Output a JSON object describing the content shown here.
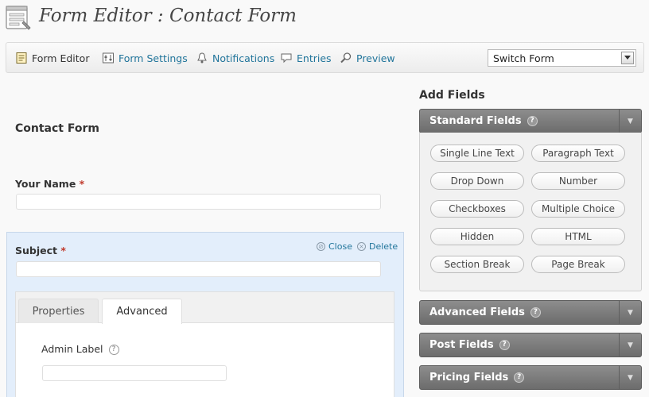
{
  "header": {
    "title": "Form Editor : Contact Form",
    "icon": "form-editor-icon"
  },
  "toolbar": {
    "items": [
      {
        "label": "Form Editor",
        "icon": "form-editor-icon",
        "active": true
      },
      {
        "label": "Form Settings",
        "icon": "settings-icon"
      },
      {
        "label": "Notifications",
        "icon": "notifications-icon"
      },
      {
        "label": "Entries",
        "icon": "entries-icon"
      },
      {
        "label": "Preview",
        "icon": "preview-icon"
      }
    ],
    "switch_form": {
      "value": "Switch Form"
    }
  },
  "form": {
    "title": "Contact Form",
    "fields": [
      {
        "label": "Your Name",
        "required": "*",
        "value": ""
      },
      {
        "label": "Subject",
        "required": "*",
        "value": ""
      }
    ],
    "actions": {
      "close": "Close",
      "delete": "Delete"
    },
    "tabs": [
      "Properties",
      "Advanced"
    ],
    "active_tab": "Advanced",
    "admin_label": {
      "label": "Admin Label",
      "help": "?",
      "value": ""
    }
  },
  "sidebar": {
    "title": "Add Fields",
    "groups": [
      {
        "label": "Standard Fields",
        "help": "?",
        "expanded": true
      },
      {
        "label": "Advanced Fields",
        "help": "?"
      },
      {
        "label": "Post Fields",
        "help": "?"
      },
      {
        "label": "Pricing Fields",
        "help": "?"
      }
    ],
    "standard_buttons": [
      "Single Line Text",
      "Paragraph Text",
      "Drop Down",
      "Number",
      "Checkboxes",
      "Multiple Choice",
      "Hidden",
      "HTML",
      "Section Break",
      "Page Break"
    ]
  },
  "colors": {
    "link": "#21759b",
    "required": "#c0392b",
    "selected_field_bg": "#e3eefb",
    "group_header": "#7a7a7a"
  }
}
